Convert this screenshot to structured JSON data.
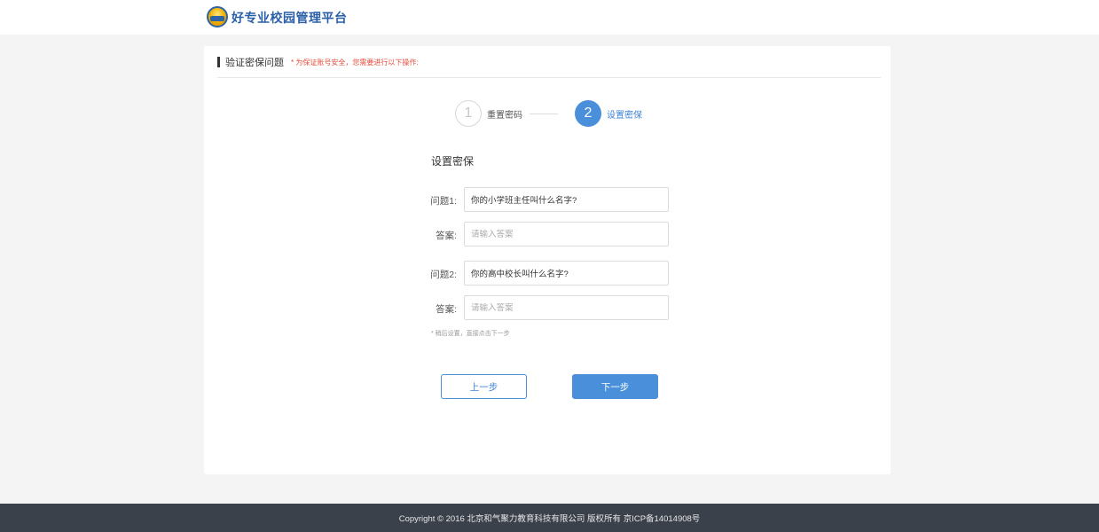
{
  "header": {
    "brand": "好专业校园管理平台",
    "logo_icon": "school-logo-icon"
  },
  "section": {
    "title": "验证密保问题",
    "hint": "* 为保证账号安全，您需要进行以下操作:"
  },
  "steps": [
    {
      "number": "1",
      "label": "重置密码",
      "state": "done"
    },
    {
      "number": "2",
      "label": "设置密保",
      "state": "active"
    }
  ],
  "form": {
    "title": "设置密保",
    "question1_label": "问题1:",
    "question1_value": "你的小学班主任叫什么名字?",
    "answer1_label": "答案:",
    "answer1_placeholder": "请输入答案",
    "question2_label": "问题2:",
    "question2_value": "你的高中校长叫什么名字?",
    "answer2_label": "答案:",
    "answer2_placeholder": "请输入答案",
    "note": "* 稍后设置，直接点击下一步"
  },
  "buttons": {
    "prev": "上一步",
    "next": "下一步"
  },
  "footer": {
    "copyright": "Copyright © 2016 北京和气聚力教育科技有限公司 版权所有 京ICP备14014908号"
  },
  "colors": {
    "accent": "#4a8fd9",
    "brand": "#2b5fa8",
    "hint": "#e64b3b",
    "footer_bg": "#3b414b"
  }
}
